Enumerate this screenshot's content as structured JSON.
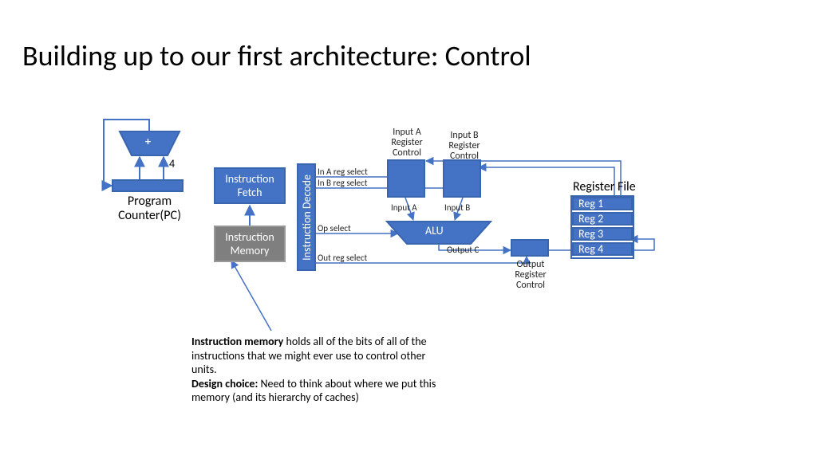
{
  "title": "Building up to our first architecture: Control",
  "pc": {
    "label": "Program\nCounter(PC)"
  },
  "adder": {
    "symbol": "+",
    "increment": "4"
  },
  "ifetch": "Instruction\nFetch",
  "imem": "Instruction\nMemory",
  "decode": "Instruction Decode",
  "signals": {
    "inAsel": "In A reg select",
    "inBsel": "In B reg select",
    "opSel": "Op select",
    "outSel": "Out reg select"
  },
  "regctrl": {
    "inA": "Input A\nRegister\nControl",
    "inB": "Input B\nRegister\nControl",
    "out": "Output\nRegister\nControl"
  },
  "aluio": {
    "inA": "Input A",
    "inB": "Input B",
    "outC": "Output C"
  },
  "alu": "ALU",
  "regfile": {
    "title": "Register File",
    "regs": [
      "Reg 1",
      "Reg 2",
      "Reg 3",
      "Reg 4"
    ]
  },
  "caption": {
    "b1": "Instruction memory",
    "t1": " holds all of the bits of all of the instructions that we might ever use to control other units.",
    "b2": "Design choice:",
    "t2": " Need to think about where we put this memory (and its hierarchy of caches)"
  }
}
